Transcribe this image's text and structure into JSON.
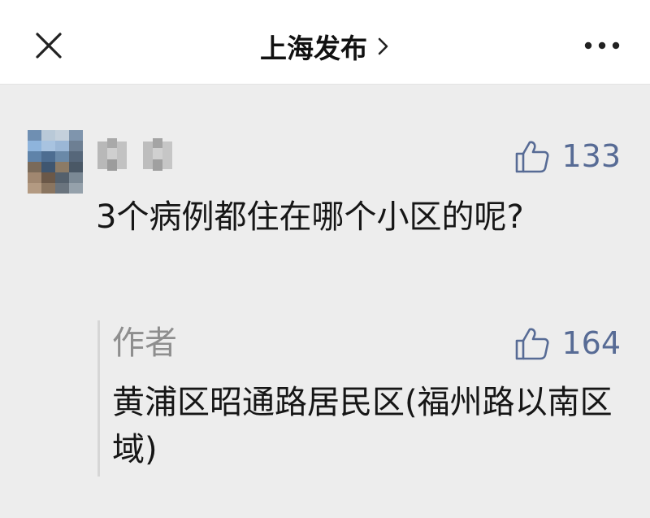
{
  "header": {
    "title": "上海发布"
  },
  "comment": {
    "likes": "133",
    "text": "3个病例都住在哪个小区的呢?"
  },
  "reply": {
    "author": "作者",
    "likes": "164",
    "text": "黄浦区昭通路居民区(福州路以南区域)"
  },
  "colors": {
    "accent": "#576b95",
    "background": "#ededed",
    "header_bg": "#ffffff"
  },
  "icons": {
    "close": "close-icon",
    "more": "more-icon",
    "like": "thumbs-up-icon",
    "chevron": "chevron-right-icon"
  }
}
